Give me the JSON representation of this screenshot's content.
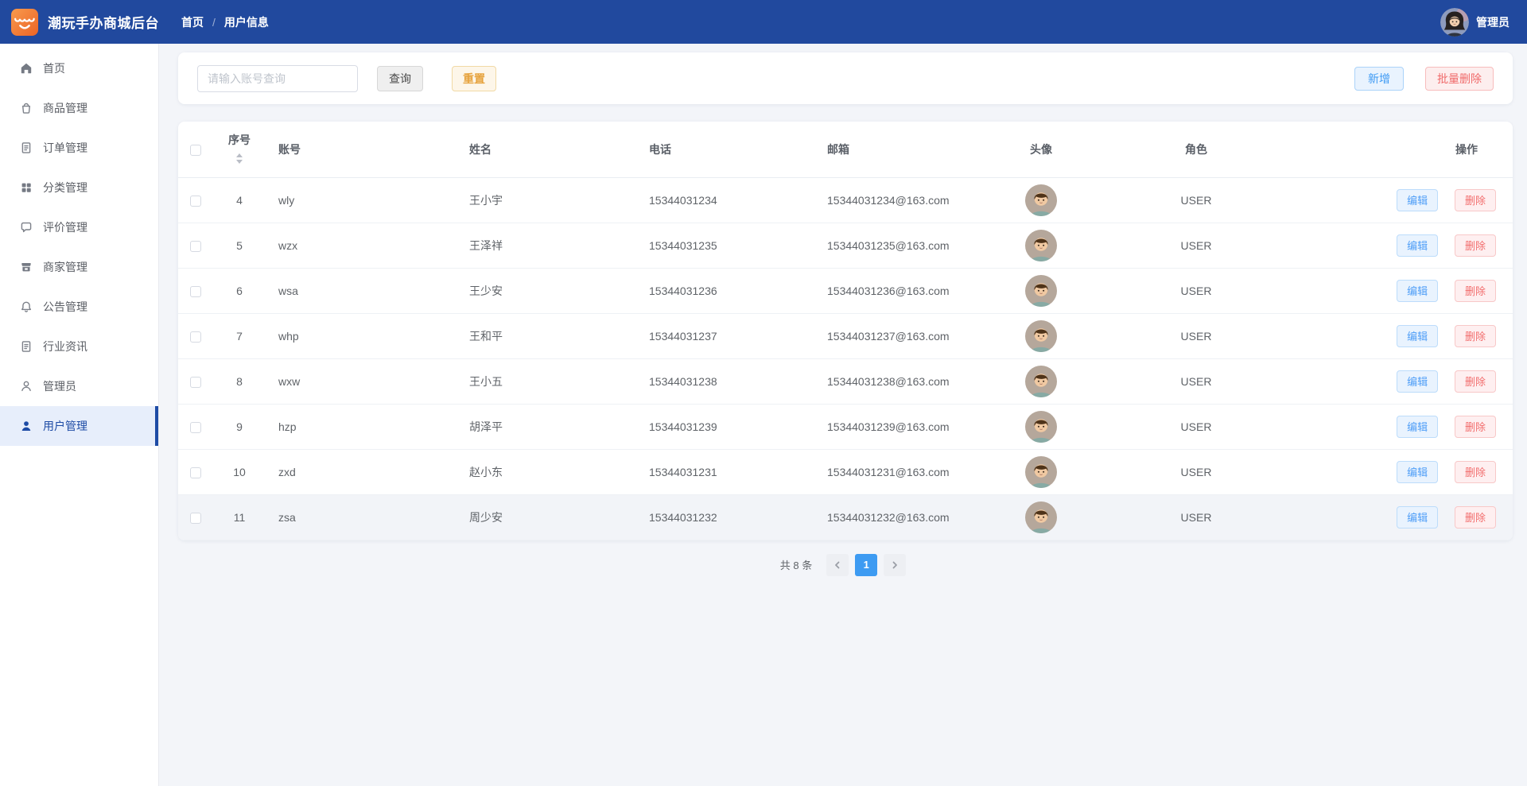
{
  "app": {
    "title": "潮玩手办商城后台"
  },
  "header": {
    "breadcrumb": [
      "首页",
      "用户信息"
    ],
    "breadcrumb_separator": "/",
    "admin_name": "管理员",
    "logo_icon": "storefront-icon",
    "avatar_icon": "admin-avatar"
  },
  "sidebar": {
    "items": [
      {
        "label": "首页",
        "icon": "home-icon",
        "active": false
      },
      {
        "label": "商品管理",
        "icon": "shopping-bag-icon",
        "active": false
      },
      {
        "label": "订单管理",
        "icon": "order-doc-icon",
        "active": false
      },
      {
        "label": "分类管理",
        "icon": "grid-icon",
        "active": false
      },
      {
        "label": "评价管理",
        "icon": "comment-icon",
        "active": false
      },
      {
        "label": "商家管理",
        "icon": "store-icon",
        "active": false
      },
      {
        "label": "公告管理",
        "icon": "bell-icon",
        "active": false
      },
      {
        "label": "行业资讯",
        "icon": "news-doc-icon",
        "active": false
      },
      {
        "label": "管理员",
        "icon": "user-outline-icon",
        "active": false
      },
      {
        "label": "用户管理",
        "icon": "user-filled-icon",
        "active": true
      }
    ]
  },
  "toolbar": {
    "search_placeholder": "请输入账号查询",
    "search_value": "",
    "query_label": "查询",
    "reset_label": "重置",
    "add_label": "新增",
    "batch_delete_label": "批量删除"
  },
  "table": {
    "columns": {
      "index": "序号",
      "account": "账号",
      "name": "姓名",
      "phone": "电话",
      "email": "邮箱",
      "avatar": "头像",
      "role": "角色",
      "actions": "操作"
    },
    "edit_label": "编辑",
    "delete_label": "删除",
    "rows": [
      {
        "index": "4",
        "account": "wly",
        "name": "王小宇",
        "phone": "15344031234",
        "email": "15344031234@163.com",
        "role": "USER"
      },
      {
        "index": "5",
        "account": "wzx",
        "name": "王泽祥",
        "phone": "15344031235",
        "email": "15344031235@163.com",
        "role": "USER"
      },
      {
        "index": "6",
        "account": "wsa",
        "name": "王少安",
        "phone": "15344031236",
        "email": "15344031236@163.com",
        "role": "USER"
      },
      {
        "index": "7",
        "account": "whp",
        "name": "王和平",
        "phone": "15344031237",
        "email": "15344031237@163.com",
        "role": "USER"
      },
      {
        "index": "8",
        "account": "wxw",
        "name": "王小五",
        "phone": "15344031238",
        "email": "15344031238@163.com",
        "role": "USER"
      },
      {
        "index": "9",
        "account": "hzp",
        "name": "胡泽平",
        "phone": "15344031239",
        "email": "15344031239@163.com",
        "role": "USER"
      },
      {
        "index": "10",
        "account": "zxd",
        "name": "赵小东",
        "phone": "15344031231",
        "email": "15344031231@163.com",
        "role": "USER"
      },
      {
        "index": "11",
        "account": "zsa",
        "name": "周少安",
        "phone": "15344031232",
        "email": "15344031232@163.com",
        "role": "USER"
      }
    ]
  },
  "pagination": {
    "total_label": "共 8 条",
    "current_page": "1",
    "prev_icon": "chevron-left-icon",
    "next_icon": "chevron-right-icon"
  },
  "colors": {
    "header_bg": "#21499e",
    "active_item_blue": "#1d4ba5",
    "accent_blue": "#409eff",
    "danger_red": "#f56c6c",
    "warning_orange": "#e6a23c",
    "logo_orange": "#ee6c2d"
  }
}
